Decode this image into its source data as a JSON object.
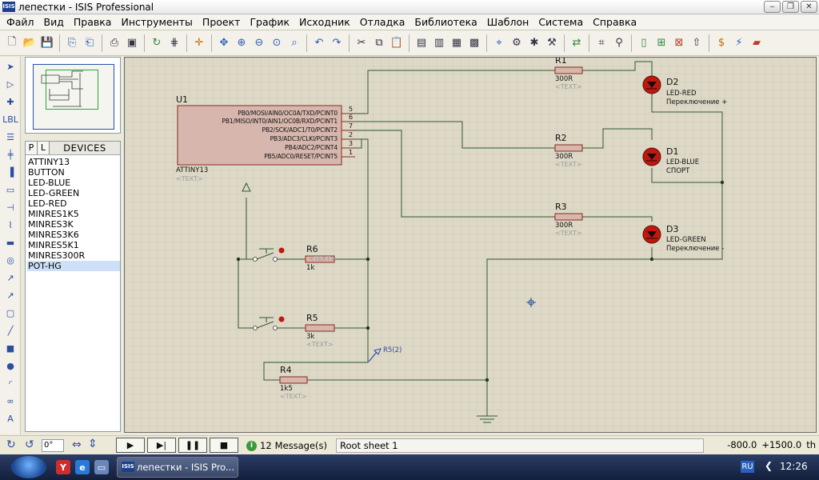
{
  "window": {
    "title": "лепестки - ISIS Professional",
    "app_icon_text": "ISIS",
    "controls": [
      "minimize",
      "maximize",
      "close"
    ]
  },
  "menu": [
    "Файл",
    "Вид",
    "Правка",
    "Инструменты",
    "Проект",
    "График",
    "Исходник",
    "Отладка",
    "Библиотека",
    "Шаблон",
    "Система",
    "Справка"
  ],
  "devices_panel": {
    "tab_p": "P",
    "tab_l": "L",
    "title": "DEVICES",
    "items": [
      "ATTINY13",
      "BUTTON",
      "LED-BLUE",
      "LED-GREEN",
      "LED-RED",
      "MINRES1K5",
      "MINRES3K",
      "MINRES3K6",
      "MINRES5K1",
      "MINRES300R",
      "POT-HG"
    ],
    "selected": "POT-HG"
  },
  "schematic": {
    "u1": {
      "ref": "U1",
      "part": "ATTINY13",
      "text": "<TEXT>",
      "pins": [
        {
          "name": "PB0/MOSI/AIN0/OC0A/TXD/PCINT0",
          "num": "5"
        },
        {
          "name": "PB1/MISO/INT0/AIN1/OC0B/RXD/PCINT1",
          "num": "6"
        },
        {
          "name": "PB2/SCK/ADC1/T0/PCINT2",
          "num": "7"
        },
        {
          "name": "PB3/ADC3/CLKI/PCINT3",
          "num": "2"
        },
        {
          "name": "PB4/ADC2/PCINT4",
          "num": "3"
        },
        {
          "name": "PB5/ADC0/RESET/PCINT5",
          "num": "1"
        }
      ]
    },
    "r1": {
      "ref": "R1",
      "value": "300R",
      "text": "<TEXT>"
    },
    "r2": {
      "ref": "R2",
      "value": "300R",
      "text": "<TEXT>"
    },
    "r3": {
      "ref": "R3",
      "value": "300R",
      "text": "<TEXT>"
    },
    "r4": {
      "ref": "R4",
      "value": "1k5",
      "text": "<TEXT>"
    },
    "r5": {
      "ref": "R5",
      "value": "3k",
      "text": "<TEXT>",
      "probe": "R5(2)"
    },
    "r6": {
      "ref": "R6",
      "value": "1k",
      "text": "<TEXT>"
    },
    "d1": {
      "ref": "D1",
      "part": "LED-BLUE",
      "note": "СПОРТ"
    },
    "d2": {
      "ref": "D2",
      "part": "LED-RED",
      "note": "Переключение +"
    },
    "d3": {
      "ref": "D3",
      "part": "LED-GREEN",
      "note": "Переключение -"
    }
  },
  "status": {
    "angle": "0°",
    "messages_count": "12",
    "messages_label": "Message(s)",
    "sheet": "Root sheet 1",
    "coord_x": "-800.0",
    "coord_y": "+1500.0",
    "units": "th"
  },
  "taskbar": {
    "task": "лепестки - ISIS Pro...",
    "task_icon_text": "ISIS",
    "lang": "RU",
    "clock": "12:26"
  },
  "colors": {
    "canvas": "#ded8c6",
    "grid": "#cbc5b2",
    "wire": "#2f5a33",
    "component_fill": "#d7b7ad",
    "component_stroke": "#8a2a1a",
    "led": "#c0170f"
  }
}
